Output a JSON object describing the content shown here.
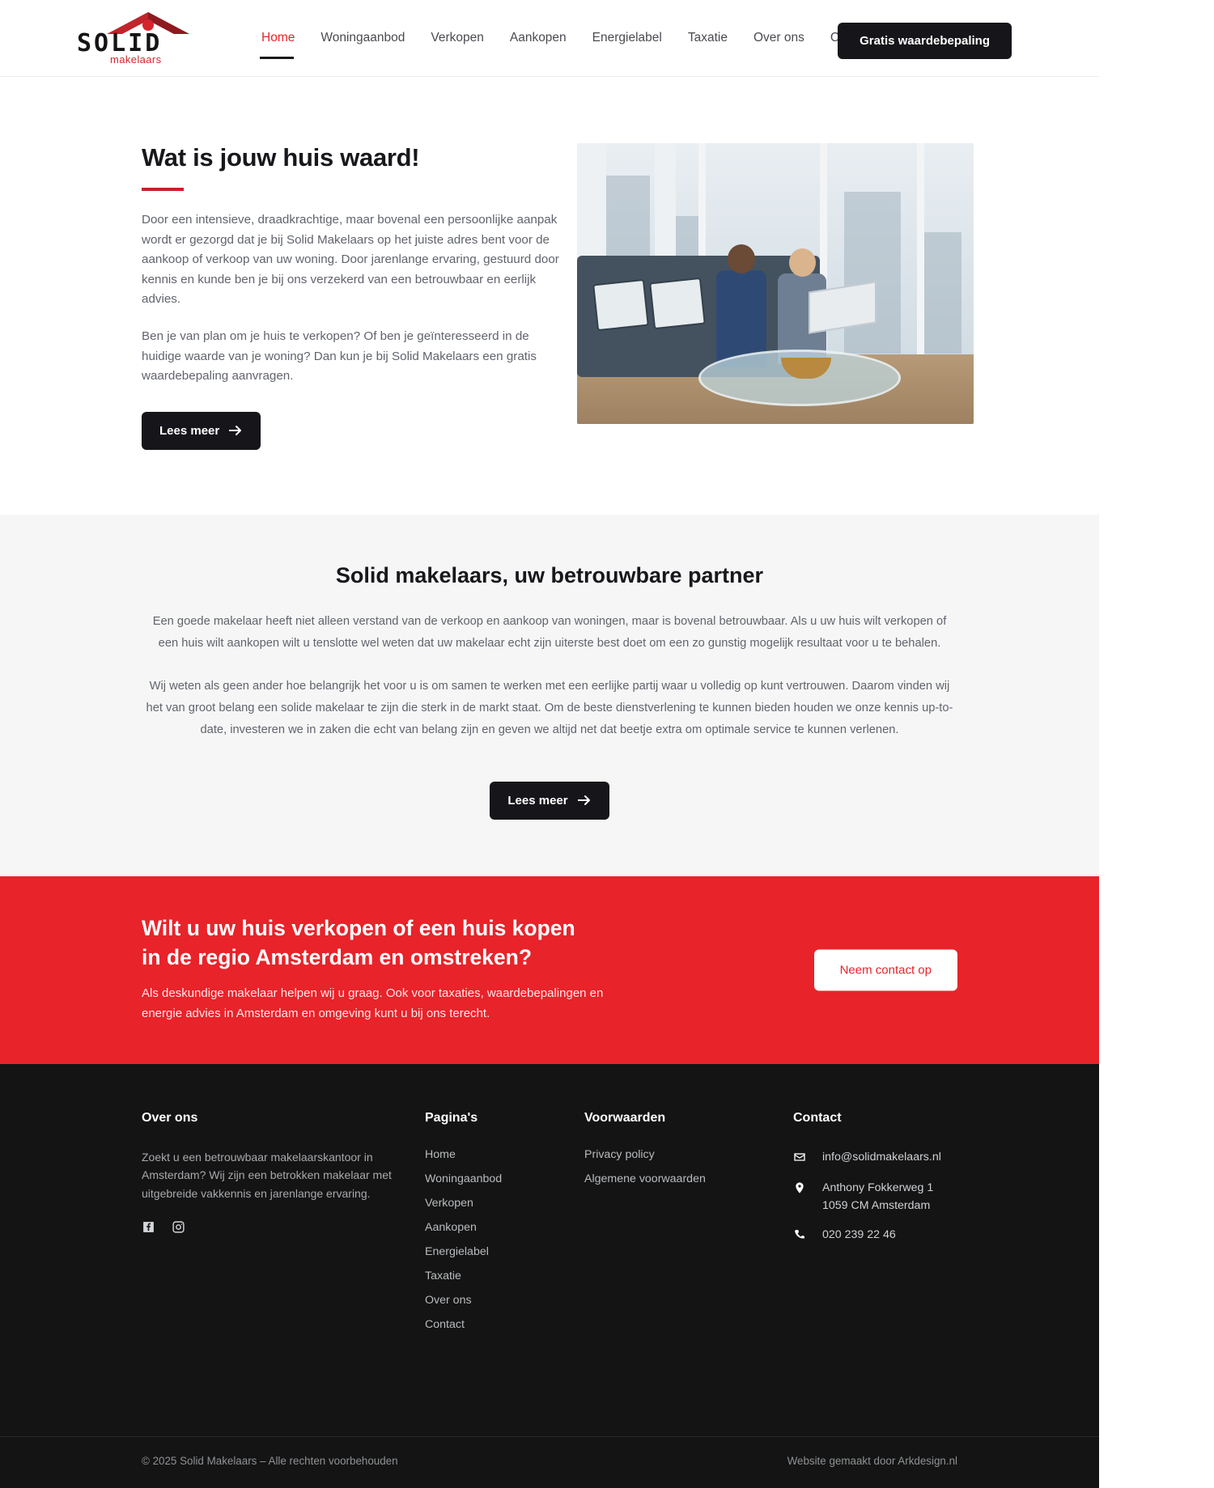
{
  "brand": {
    "logo_word": "SOLID",
    "logo_sub": "makelaars",
    "accent_red": "#e8232a",
    "logo_red": "#d12b2b",
    "dark": "#16161a"
  },
  "header": {
    "nav": [
      {
        "label": "Home",
        "active": true
      },
      {
        "label": "Woningaanbod",
        "active": false
      },
      {
        "label": "Verkopen",
        "active": false
      },
      {
        "label": "Aankopen",
        "active": false
      },
      {
        "label": "Energielabel",
        "active": false
      },
      {
        "label": "Taxatie",
        "active": false
      },
      {
        "label": "Over ons",
        "active": false
      },
      {
        "label": "Contact",
        "active": false
      }
    ],
    "cta_label": "Gratis waardebepaling"
  },
  "hero": {
    "title": "Wat is jouw huis waard!",
    "paragraph1": "Door een intensieve, draadkrachtige, maar bovenal een persoonlijke aanpak wordt er gezorgd dat je bij Solid Makelaars op het juiste adres bent voor de aankoop of verkoop van uw woning. Door jarenlange ervaring, gestuurd door kennis en kunde ben je bij ons verzekerd van een betrouwbaar en eerlijk advies.",
    "paragraph2": "Ben je van plan om je huis te verkopen? Of ben je geïnteresseerd in de huidige waarde van je woning? Dan kun je bij Solid Makelaars een gratis waardebepaling aanvragen.",
    "button_label": "Lees meer",
    "image_alt": "Twee makelaars in gesprek op een bank bij een kantoorraam"
  },
  "mid": {
    "title": "Solid makelaars, uw betrouwbare partner",
    "paragraph1": "Een goede makelaar heeft niet alleen verstand van de verkoop en aankoop van woningen, maar is bovenal betrouwbaar. Als u uw huis wilt verkopen of een huis wilt aankopen wilt u tenslotte wel weten dat uw makelaar echt zijn uiterste best doet om een zo gunstig mogelijk resultaat voor u te behalen.",
    "paragraph2": "Wij weten als geen ander hoe belangrijk het voor u is om samen te werken met een eerlijke partij waar u volledig op kunt vertrouwen. Daarom vinden wij het van groot belang een solide makelaar te zijn die sterk in de markt staat. Om de beste dienstverlening te kunnen bieden houden we onze kennis up-to-date, investeren we in zaken die echt van belang zijn en geven we altijd net dat beetje extra om optimale service te kunnen verlenen.",
    "button_label": "Lees meer"
  },
  "cta": {
    "title_line1": "Wilt u uw huis verkopen of een huis kopen",
    "title_line2": "in de regio Amsterdam en omstreken?",
    "paragraph": "Als deskundige makelaar helpen wij u graag. Ook voor taxaties, waardebepalingen en energie advies in Amsterdam en omgeving kunt u bij ons terecht.",
    "button_label": "Neem contact op"
  },
  "footer": {
    "about": {
      "heading": "Over ons",
      "text": "Zoekt u een betrouwbaar makelaarskantoor in Amsterdam? Wij zijn een betrokken makelaar met uitgebreide vakkennis en jarenlange ervaring.",
      "social": [
        {
          "name": "facebook-icon"
        },
        {
          "name": "instagram-icon"
        }
      ]
    },
    "pages": {
      "heading": "Pagina's",
      "links": [
        "Home",
        "Woningaanbod",
        "Verkopen",
        "Aankopen",
        "Energielabel",
        "Taxatie",
        "Over ons",
        "Contact"
      ]
    },
    "terms": {
      "heading": "Voorwaarden",
      "links": [
        "Privacy policy",
        "Algemene voorwaarden"
      ]
    },
    "contact": {
      "heading": "Contact",
      "email": "info@solidmakelaars.nl",
      "address_line1": "Anthony Fokkerweg 1",
      "address_line2": "1059 CM Amsterdam",
      "phone": "020 239 22 46"
    },
    "bottom": {
      "copyright": "© 2025 Solid Makelaars – Alle rechten voorbehouden",
      "credit": "Website gemaakt door Arkdesign.nl"
    }
  }
}
